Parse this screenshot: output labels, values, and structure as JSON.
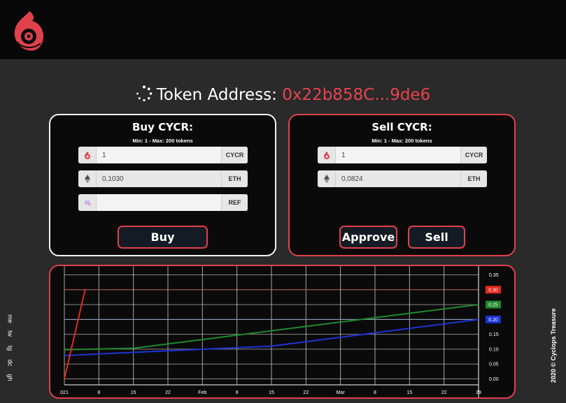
{
  "header": {
    "logo": "cyclops-logo"
  },
  "token": {
    "label": "Token Address:",
    "address": "0x22b858C...9de6"
  },
  "buy": {
    "title": "Buy CYCR:",
    "limits": "Min: 1 - Max: 200 tokens",
    "amount": {
      "value": "1",
      "suffix": "CYCR",
      "icon": "cyclops-token-icon"
    },
    "cost": {
      "value": "0,1030",
      "suffix": "ETH",
      "icon": "ethereum-icon"
    },
    "ref": {
      "value": "",
      "suffix": "REF",
      "icon": "referral-icon"
    },
    "button": "Buy"
  },
  "sell": {
    "title": "Sell CYCR:",
    "limits": "Min: 1 - Max: 200 tokens",
    "amount": {
      "value": "1",
      "suffix": "CYCR",
      "icon": "cyclops-token-icon"
    },
    "receive": {
      "value": "0,0824",
      "suffix": "ETH",
      "icon": "ethereum-icon"
    },
    "approve_button": "Approve",
    "sell_button": "Sell"
  },
  "social": [
    "me",
    "tw",
    "tg",
    "dc",
    "gh"
  ],
  "footer": {
    "copyright": "2020 © Cyclops Treasure"
  },
  "colors": {
    "accent": "#e0414d",
    "address": "#e8434f",
    "green": "#1e8a2e",
    "blue": "#1f33d6",
    "red": "#e8281e",
    "steel": "#8f9fc4"
  },
  "chart_data": {
    "type": "line",
    "x_tick_labels": [
      "021",
      "8",
      "15",
      "22",
      "Feb",
      "8",
      "15",
      "22",
      "Mar",
      "8",
      "15",
      "22",
      "29"
    ],
    "y_ticks": [
      0,
      0.05,
      0.1,
      0.15,
      0.2,
      0.25,
      0.3,
      0.35
    ],
    "y_tick_labels": [
      "0.00",
      "0.05",
      "0.10",
      "0.15",
      "0.20",
      "0.25",
      "0.30",
      "0.35"
    ],
    "ylim": [
      -0.02,
      0.37
    ],
    "grid": true,
    "series": [
      {
        "color": "#1e8a2e",
        "points": [
          [
            0,
            0.098
          ],
          [
            2,
            0.103
          ],
          [
            12,
            0.25
          ]
        ]
      },
      {
        "color": "#1f33d6",
        "points": [
          [
            0,
            0.078
          ],
          [
            1,
            0.084
          ],
          [
            6,
            0.11
          ],
          [
            12,
            0.2
          ]
        ]
      },
      {
        "color": "#e8281e",
        "points": [
          [
            0,
            0.0
          ],
          [
            0.6,
            0.3
          ]
        ]
      }
    ],
    "reference_lines": [
      {
        "value": 0.3,
        "style": "dotted",
        "color": "#e8281e"
      },
      {
        "value": 0.2,
        "style": "solid",
        "color": "#8f9fc4"
      }
    ],
    "price_badges": [
      {
        "value": 0.3,
        "label": "0.30",
        "color": "#e8281e"
      },
      {
        "value": 0.25,
        "label": "0.25",
        "color": "#1e8a2e"
      },
      {
        "value": 0.2,
        "label": "0.20",
        "color": "#1f33d6"
      }
    ]
  }
}
